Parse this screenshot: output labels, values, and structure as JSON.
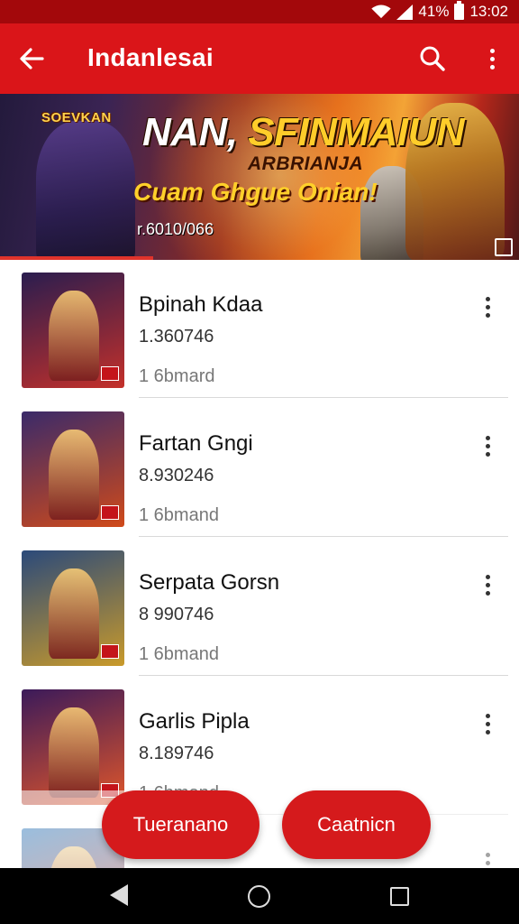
{
  "status_bar": {
    "battery": "41%",
    "time": "13:02"
  },
  "app_bar": {
    "title": "Indanlesai"
  },
  "banner": {
    "logo_text": "SOEVKAN",
    "title_main": "NAN, ",
    "title_accent": "SFINMAIUN",
    "subtitle": "ARBRIANJA",
    "tagline": "Cuam Ghgue Onian!",
    "code": "r.6010/066",
    "colors": {
      "primary": "#da1519",
      "accent": "#ffcd2a"
    }
  },
  "games": [
    {
      "name": "Bpinah Kdaa",
      "size": "1.360746",
      "downloads": "1 6bmard",
      "colors": [
        "#2a1d4f",
        "#c4302a"
      ]
    },
    {
      "name": "Fartan Gngi",
      "size": "8.930246",
      "downloads": "1 6bmand",
      "colors": [
        "#3a2a6a",
        "#d04a1a"
      ]
    },
    {
      "name": "Serpata Gorsn",
      "size": "8 990746",
      "downloads": "1 6bmand",
      "colors": [
        "#2b4a7a",
        "#c99a2a"
      ]
    },
    {
      "name": "Garlis Pipla",
      "size": "8.189746",
      "downloads": "1 6bmand",
      "colors": [
        "#3b1a5a",
        "#e0562a"
      ]
    },
    {
      "name": "",
      "size": "",
      "downloads": "",
      "colors": [
        "#1f6fb5",
        "#e04a2a"
      ]
    }
  ],
  "actions": {
    "left_label": "Tueranano",
    "right_label": "Caatnicn"
  },
  "icons": {
    "back": "arrow-left-icon",
    "search": "search-icon",
    "overflow": "more-vert-icon",
    "item_menu": "more-vert-icon",
    "nav": [
      "nav-back-icon",
      "nav-home-icon",
      "nav-recents-icon"
    ]
  }
}
